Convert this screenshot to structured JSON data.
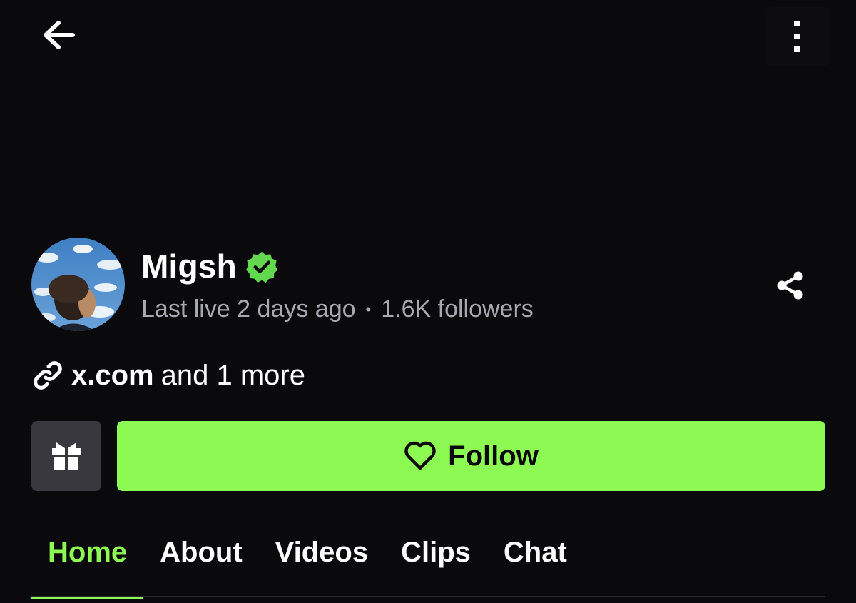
{
  "header": {
    "back_icon": "arrow-left-icon",
    "more_icon": "more-vertical-icon"
  },
  "profile": {
    "name": "Migsh",
    "verified": true,
    "verified_icon": "verified-badge-icon",
    "last_live": "Last live 2 days ago",
    "separator": "•",
    "followers": "1.6K followers",
    "share_icon": "share-icon"
  },
  "links": {
    "icon": "link-icon",
    "primary": "x.com",
    "more": "and 1 more"
  },
  "actions": {
    "gift_icon": "gift-icon",
    "follow_icon": "heart-outline-icon",
    "follow_label": "Follow"
  },
  "tabs": [
    {
      "label": "Home",
      "active": true
    },
    {
      "label": "About",
      "active": false
    },
    {
      "label": "Videos",
      "active": false
    },
    {
      "label": "Clips",
      "active": false
    },
    {
      "label": "Chat",
      "active": false
    }
  ],
  "colors": {
    "background": "#0a0a0c",
    "accent": "#8cfa52",
    "muted_text": "#a8a8b0",
    "gift_button_bg": "#38383e",
    "verified_badge": "#62d84f"
  }
}
